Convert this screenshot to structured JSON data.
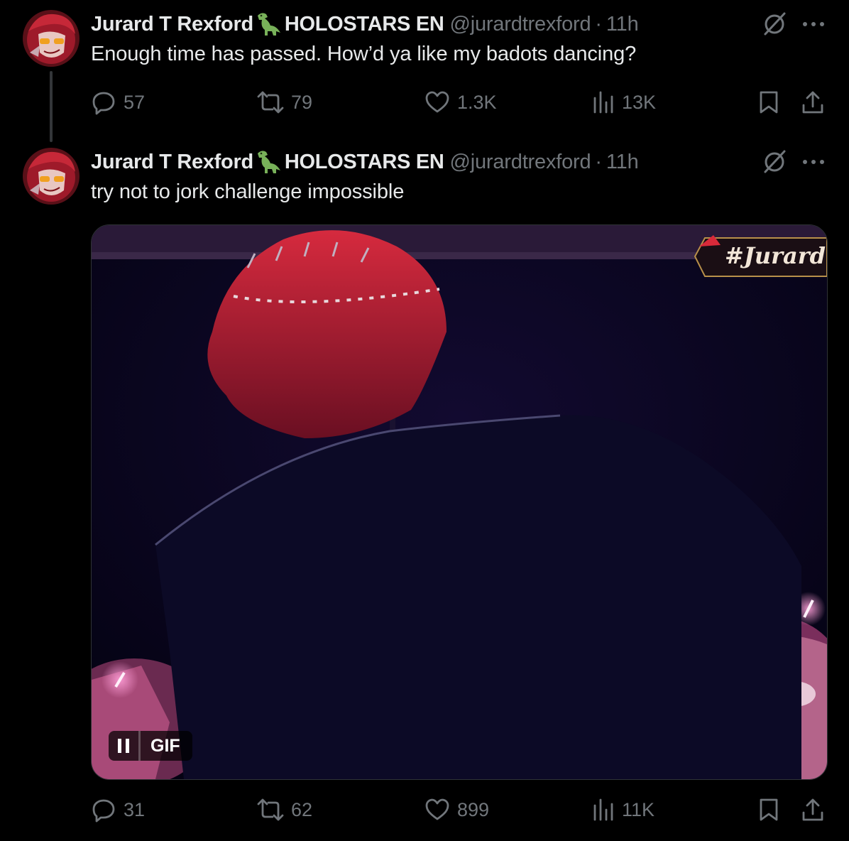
{
  "colors": {
    "background": "#000000",
    "text_primary": "#e7e9ea",
    "text_secondary": "#71767b",
    "thread_line": "#333639",
    "media_border": "#2f3336"
  },
  "icons": {
    "reply": "reply-icon",
    "retweet": "retweet-icon",
    "like": "heart-icon",
    "views": "views-icon",
    "bookmark": "bookmark-icon",
    "share": "share-icon",
    "grok": "grok-icon",
    "more": "more-icon",
    "pause": "pause-icon",
    "dino": "dinosaur-emoji-icon"
  },
  "tweets": [
    {
      "author_name": "Jurard T Rexford",
      "author_suffix": "HOLOSTARS EN",
      "handle": "@jurardtrexford",
      "separator": "·",
      "time": "11h",
      "text": "Enough time has passed. How’d ya like my badots dancing?",
      "stats": {
        "replies": "57",
        "retweets": "79",
        "likes": "1.3K",
        "views": "13K"
      }
    },
    {
      "author_name": "Jurard T Rexford",
      "author_suffix": "HOLOSTARS EN",
      "handle": "@jurardtrexford",
      "separator": "·",
      "time": "11h",
      "text": "try not to jork challenge impossible",
      "media": {
        "badge": "GIF",
        "watermark": "#Jurard"
      },
      "stats": {
        "replies": "31",
        "retweets": "62",
        "likes": "899",
        "views": "11K"
      }
    }
  ]
}
